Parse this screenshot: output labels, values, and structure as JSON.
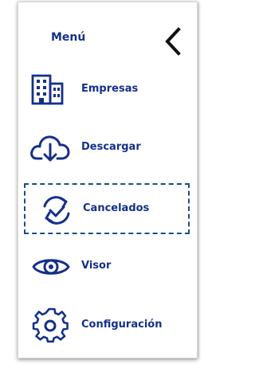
{
  "menu": {
    "title": "Menú",
    "back_icon": "chevron-left-icon",
    "colors": {
      "text": "#15308a",
      "icon": "#15308a",
      "active_border": "#1c4e8c"
    },
    "items": [
      {
        "label": "Empresas",
        "icon": "building-icon",
        "active": false
      },
      {
        "label": "Descargar",
        "icon": "cloud-download-icon",
        "active": false
      },
      {
        "label": "Cancelados",
        "icon": "sync-check-icon",
        "active": true
      },
      {
        "label": "Visor",
        "icon": "eye-icon",
        "active": false
      },
      {
        "label": "Configuración",
        "icon": "gear-icon",
        "active": false
      }
    ]
  }
}
